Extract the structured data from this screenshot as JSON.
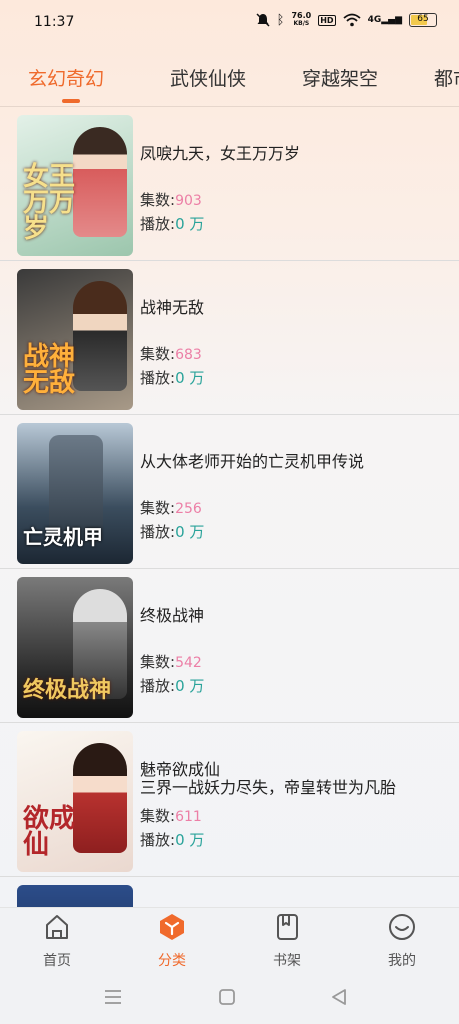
{
  "status_bar": {
    "time": "11:37",
    "net_speed": "76.0",
    "net_unit": "KB/S",
    "hd": "HD",
    "signal": "4G",
    "battery": "65"
  },
  "tabs": [
    {
      "label": "玄幻奇幻",
      "active": true
    },
    {
      "label": "武侠仙侠",
      "active": false
    },
    {
      "label": "穿越架空",
      "active": false
    },
    {
      "label": "都市",
      "active": false
    }
  ],
  "labels": {
    "episodes": "集数:",
    "plays": "播放:",
    "plays_unit": " 万"
  },
  "books": [
    {
      "title": "凤唳九天，女王万万岁",
      "subtitle": "",
      "episodes": "903",
      "plays": "0",
      "cover_text": "女王万万岁",
      "cover_colors": [
        "#cfe8d8",
        "#7fb59a"
      ]
    },
    {
      "title": "战神无敌",
      "subtitle": "",
      "episodes": "683",
      "plays": "0",
      "cover_text": "战神无敌",
      "cover_colors": [
        "#2b2b2b",
        "#8c7d6d"
      ]
    },
    {
      "title": "从大体老师开始的亡灵机甲传说",
      "subtitle": "",
      "episodes": "256",
      "plays": "0",
      "cover_text": "亡灵机甲",
      "cover_colors": [
        "#9bb0c4",
        "#2c3e50"
      ]
    },
    {
      "title": "终极战神",
      "subtitle": "",
      "episodes": "542",
      "plays": "0",
      "cover_text": "终极战神",
      "cover_colors": [
        "#5d5d5d",
        "#1d1d1d"
      ]
    },
    {
      "title": "魅帝欲成仙",
      "subtitle": "三界一战妖力尽失，帝皇转世为凡胎",
      "episodes": "611",
      "plays": "0",
      "cover_text": "欲成仙",
      "cover_colors": [
        "#f3ede6",
        "#b23a3a"
      ]
    },
    {
      "title": "",
      "subtitle": "",
      "episodes": "",
      "plays": "",
      "cover_text": "",
      "cover_colors": [
        "#1f3a6e",
        "#0d1a33"
      ]
    }
  ],
  "bottom_nav": [
    {
      "label": "首页",
      "icon": "home-icon",
      "active": false
    },
    {
      "label": "分类",
      "icon": "category-icon",
      "active": true
    },
    {
      "label": "书架",
      "icon": "bookshelf-icon",
      "active": false
    },
    {
      "label": "我的",
      "icon": "profile-icon",
      "active": false
    }
  ],
  "colors": {
    "accent": "#ef6a2c",
    "episodes": "#ec7fa6",
    "plays": "#2aa39a"
  }
}
